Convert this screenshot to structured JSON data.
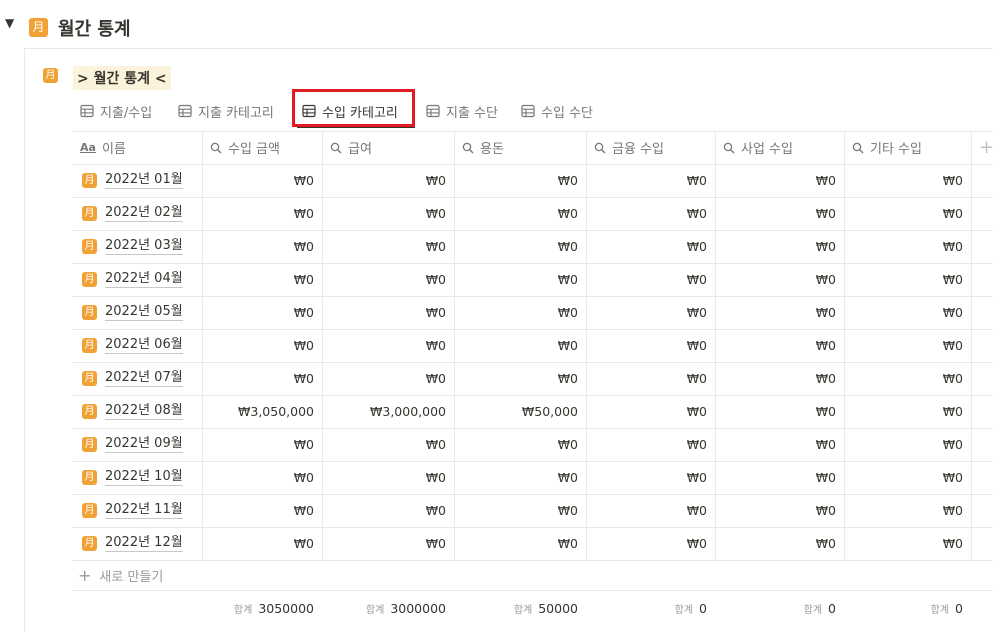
{
  "page": {
    "title": "월간 통계",
    "month_glyph": "月",
    "toggle_glyph": "▼"
  },
  "database": {
    "title": "> 월간 통계 <"
  },
  "tabs": [
    {
      "label": "지출/수입",
      "active": false
    },
    {
      "label": "지출 카테고리",
      "active": false
    },
    {
      "label": "수입 카테고리",
      "active": true
    },
    {
      "label": "지출 수단",
      "active": false
    },
    {
      "label": "수입 수단",
      "active": false
    }
  ],
  "columns": [
    {
      "label": "이름",
      "icon": "text-icon",
      "icon_glyph": "Aa"
    },
    {
      "label": "수입 금액",
      "icon": "search-icon"
    },
    {
      "label": "급여",
      "icon": "search-icon"
    },
    {
      "label": "용돈",
      "icon": "search-icon"
    },
    {
      "label": "금융 수입",
      "icon": "search-icon"
    },
    {
      "label": "사업 수입",
      "icon": "search-icon"
    },
    {
      "label": "기타 수입",
      "icon": "search-icon"
    }
  ],
  "add_column_glyph": "+",
  "rows": [
    {
      "name": "2022년 01월",
      "values": [
        "₩0",
        "₩0",
        "₩0",
        "₩0",
        "₩0",
        "₩0"
      ]
    },
    {
      "name": "2022년 02월",
      "values": [
        "₩0",
        "₩0",
        "₩0",
        "₩0",
        "₩0",
        "₩0"
      ]
    },
    {
      "name": "2022년 03월",
      "values": [
        "₩0",
        "₩0",
        "₩0",
        "₩0",
        "₩0",
        "₩0"
      ]
    },
    {
      "name": "2022년 04월",
      "values": [
        "₩0",
        "₩0",
        "₩0",
        "₩0",
        "₩0",
        "₩0"
      ]
    },
    {
      "name": "2022년 05월",
      "values": [
        "₩0",
        "₩0",
        "₩0",
        "₩0",
        "₩0",
        "₩0"
      ]
    },
    {
      "name": "2022년 06월",
      "values": [
        "₩0",
        "₩0",
        "₩0",
        "₩0",
        "₩0",
        "₩0"
      ]
    },
    {
      "name": "2022년 07월",
      "values": [
        "₩0",
        "₩0",
        "₩0",
        "₩0",
        "₩0",
        "₩0"
      ]
    },
    {
      "name": "2022년 08월",
      "values": [
        "₩3,050,000",
        "₩3,000,000",
        "₩50,000",
        "₩0",
        "₩0",
        "₩0"
      ]
    },
    {
      "name": "2022년 09월",
      "values": [
        "₩0",
        "₩0",
        "₩0",
        "₩0",
        "₩0",
        "₩0"
      ]
    },
    {
      "name": "2022년 10월",
      "values": [
        "₩0",
        "₩0",
        "₩0",
        "₩0",
        "₩0",
        "₩0"
      ]
    },
    {
      "name": "2022년 11월",
      "values": [
        "₩0",
        "₩0",
        "₩0",
        "₩0",
        "₩0",
        "₩0"
      ]
    },
    {
      "name": "2022년 12월",
      "values": [
        "₩0",
        "₩0",
        "₩0",
        "₩0",
        "₩0",
        "₩0"
      ]
    }
  ],
  "new_row": {
    "glyph": "+",
    "label": "새로 만들기"
  },
  "sums": {
    "label": "합계",
    "values": [
      "3050000",
      "3000000",
      "50000",
      "0",
      "0",
      "0"
    ]
  },
  "colors": {
    "accent_orange": "#f0a236",
    "highlight_red": "#e21b23",
    "title_bg": "#fbf3db"
  }
}
